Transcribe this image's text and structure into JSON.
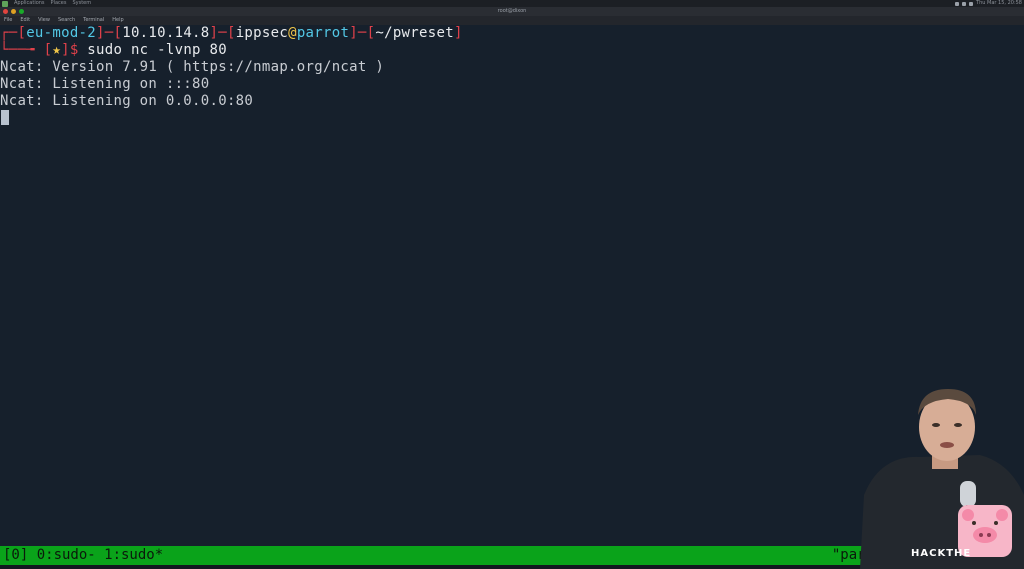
{
  "system_panel": {
    "menus": [
      "Applications",
      "Places",
      "System"
    ],
    "clock": "Thu Mar 15, 20:58"
  },
  "window": {
    "title": "root@dixon"
  },
  "menu_bar": [
    "File",
    "Edit",
    "View",
    "Search",
    "Terminal",
    "Help"
  ],
  "terminal": {
    "prompt": {
      "corner_top": "┌─[",
      "host": "eu-mod-2",
      "sep1": "]─[",
      "ip": "10.10.14.8",
      "sep2": "]─[",
      "user": "ippsec",
      "at": "@",
      "machine": "parrot",
      "sep3": "]─[",
      "path": "~/pwreset",
      "close": "]",
      "corner_bottom": "└──╼ [",
      "star": "★",
      "dollar_prefix": "]$ ",
      "command": "sudo nc -lvnp 80"
    },
    "output": [
      "Ncat: Version 7.91 ( https://nmap.org/ncat )",
      "Ncat: Listening on :::80",
      "Ncat: Listening on 0.0.0.0:80"
    ]
  },
  "tmux": {
    "left": "[0] 0:sudo- 1:sudo*",
    "right": "\"parr"
  },
  "overlay": {
    "brand": "HACKTHE"
  },
  "colors": {
    "terminal_bg": "#16202c",
    "prompt_red": "#e0414a",
    "prompt_cyan": "#53c8e6",
    "prompt_yellow": "#f0c649",
    "tmux_green": "#0aa31a"
  }
}
